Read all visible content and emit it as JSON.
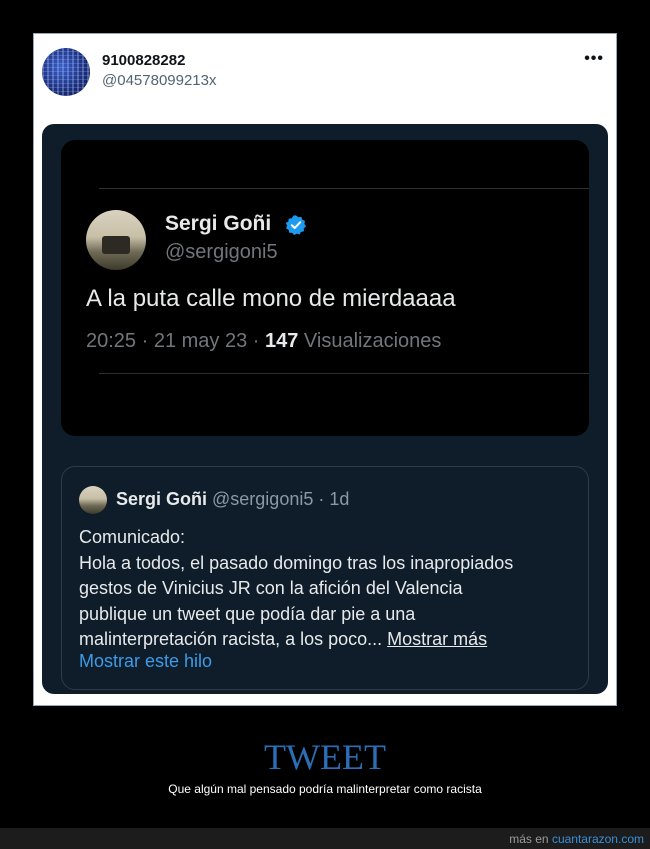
{
  "tweet": {
    "display_name": "9100828282",
    "handle": "@04578099213x",
    "more_icon": "more-horizontal-icon"
  },
  "screenshot": {
    "name": "Sergi Goñi",
    "verified_icon": "verified-badge-icon",
    "verified_color": "#1d9bf0",
    "handle": "@sergigoni5",
    "text": "A la puta calle mono de mierdaaaa",
    "time": "20:25 · 21 may 23 · ",
    "views_count": "147",
    "views_label": " Visualizaciones"
  },
  "quote": {
    "name": "Sergi Goñi",
    "handle_time": " @sergigoni5 · 1d",
    "body_lines": [
      "Comunicado:",
      "Hola a todos, el pasado domingo tras los inapropiados",
      "gestos de Vinicius JR con la afición del Valencia",
      "publique un tweet que podía dar pie a una",
      "malinterpretación racista, a los poco... "
    ],
    "show_more": "Mostrar más",
    "show_thread": "Mostrar este hilo",
    "link_color": "#3b9be8"
  },
  "caption": {
    "title": "TWEET",
    "subtitle": "Que algún mal pensado podría malinterpretar como racista"
  },
  "footer": {
    "prefix": "más en ",
    "link": "cuantarazon.com"
  }
}
